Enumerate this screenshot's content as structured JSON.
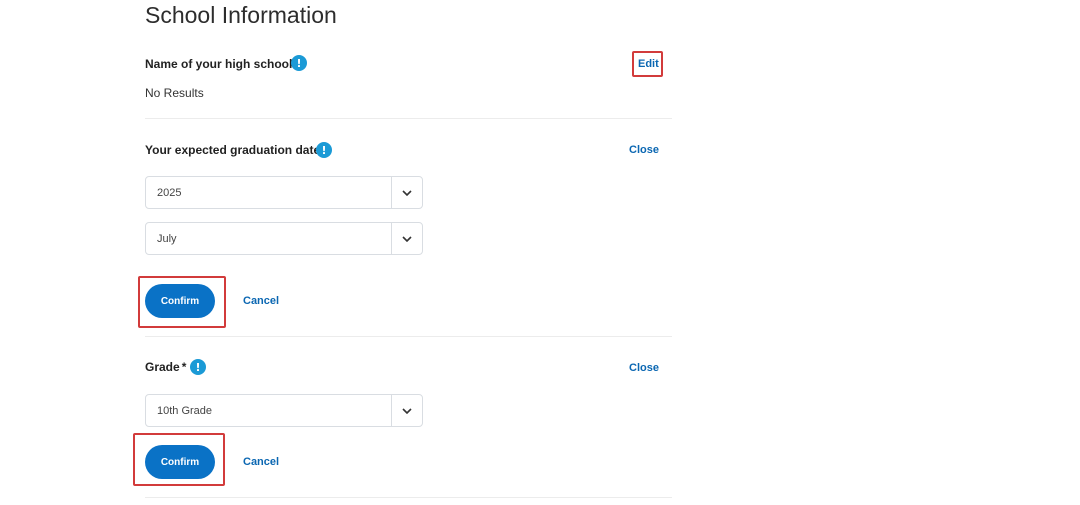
{
  "page": {
    "title": "School Information"
  },
  "high_school": {
    "label": "Name of your high school",
    "required_mark": "*",
    "info_icon_glyph": "!",
    "edit_label": "Edit",
    "value": "No Results"
  },
  "graduation": {
    "label": "Your expected graduation date",
    "required_mark": "*",
    "info_icon_glyph": "!",
    "close_label": "Close",
    "year_value": "2025",
    "month_value": "July",
    "confirm_label": "Confirm",
    "cancel_label": "Cancel"
  },
  "grade": {
    "label": "Grade",
    "required_mark": "*",
    "info_icon_glyph": "!",
    "close_label": "Close",
    "value": "10th Grade",
    "confirm_label": "Confirm",
    "cancel_label": "Cancel"
  },
  "colors": {
    "accent": "#0a72c6",
    "link": "#0b67b2",
    "info_icon": "#1b9ad6",
    "highlight_box": "#d23b3b"
  },
  "icons": {
    "info": "info-icon",
    "chevron": "chevron-down-icon"
  }
}
